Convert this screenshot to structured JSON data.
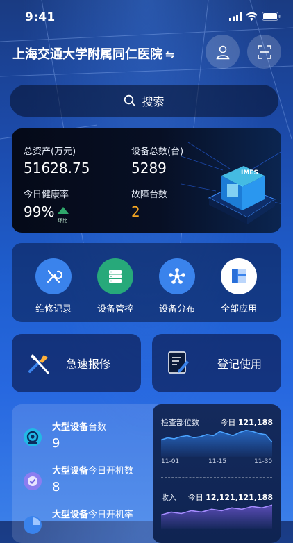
{
  "status_bar": {
    "time": "9:41"
  },
  "header": {
    "hospital_name": "上海交通大学附属同仁医院",
    "switch_glyph": "⇋"
  },
  "search": {
    "label": "搜索"
  },
  "stats": {
    "total_assets_label": "总资产(万元)",
    "total_assets_value": "51628.75",
    "device_total_label": "设备总数(台)",
    "device_total_value": "5289",
    "health_rate_label": "今日健康率",
    "health_rate_value": "99%",
    "health_rate_badge": "环比",
    "fault_label": "故障台数",
    "fault_value": "2",
    "chip_text": "IMES",
    "colors": {
      "fault": "#f5a623",
      "badge": "#2fa86b"
    }
  },
  "quick_actions": [
    {
      "label": "维修记录",
      "icon": "wrench-screwdriver-icon",
      "color": "#3a83ec"
    },
    {
      "label": "设备管控",
      "icon": "server-icon",
      "color": "#27a97a"
    },
    {
      "label": "设备分布",
      "icon": "network-nodes-icon",
      "color": "#3a83ec"
    },
    {
      "label": "全部应用",
      "icon": "grid-apps-icon",
      "color": "#ffffff"
    }
  ],
  "big_buttons": [
    {
      "label": "急速报修",
      "icon": "repair-tools-icon"
    },
    {
      "label": "登记使用",
      "icon": "register-edit-icon"
    }
  ],
  "metrics": [
    {
      "title_bold": "大型设备",
      "title_rest": "台数",
      "value": "9"
    },
    {
      "title_bold": "大型设备",
      "title_rest": "今日开机数",
      "value": "8"
    },
    {
      "title_bold": "大型设备",
      "title_rest": "今日开机率",
      "value": ""
    }
  ],
  "charts": [
    {
      "title": "检查部位数",
      "today_label": "今日",
      "today_value": "121,188",
      "x_ticks": [
        "11-01",
        "11-15",
        "11-30"
      ],
      "chart_data": {
        "type": "area",
        "values": [
          16,
          18,
          17,
          19,
          20,
          18,
          19,
          21,
          20,
          24,
          22,
          20,
          23,
          25,
          24,
          22,
          21,
          14
        ]
      }
    },
    {
      "title": "收入",
      "today_label": "今日",
      "today_value": "12,121,121,188",
      "chart_data": {
        "type": "area",
        "values": [
          10,
          12,
          11,
          13,
          12,
          14,
          13,
          15,
          14,
          16,
          15,
          17
        ]
      }
    }
  ]
}
